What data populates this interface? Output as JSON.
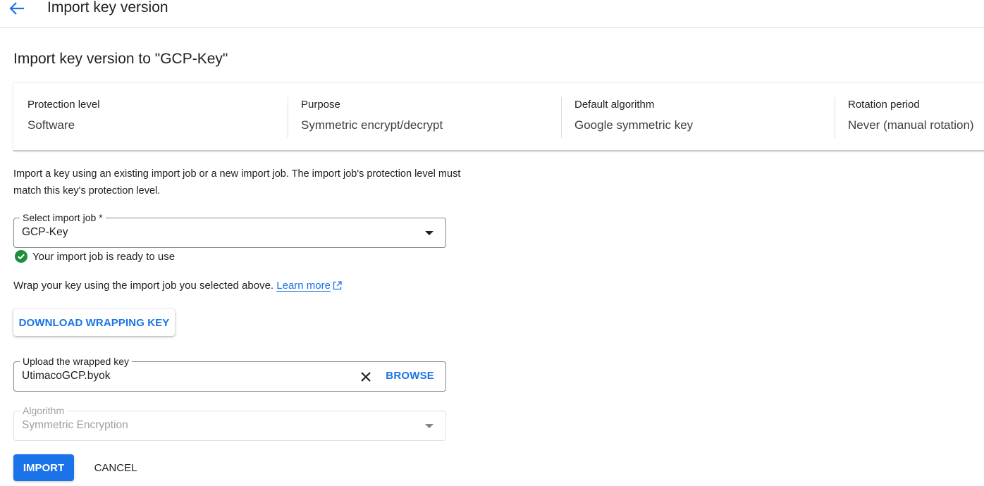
{
  "header": {
    "title": "Import key version",
    "back_icon": "arrow-back-icon"
  },
  "main": {
    "title": "Import key version to \"GCP-Key\""
  },
  "summary": [
    {
      "label": "Protection level",
      "value": "Software"
    },
    {
      "label": "Purpose",
      "value": "Symmetric encrypt/decrypt"
    },
    {
      "label": "Default algorithm",
      "value": "Google symmetric key"
    },
    {
      "label": "Rotation period",
      "value": "Never (manual rotation)"
    }
  ],
  "description": "Import a key using an existing import job or a new import job. The import job's protection level must match this key's protection level.",
  "import_job": {
    "label": "Select import job *",
    "value": "GCP-Key",
    "status_text": "Your import job is ready to use",
    "status_color": "#1e8e3e"
  },
  "wrap": {
    "text": "Wrap your key using the import job you selected above. ",
    "link_text": "Learn more",
    "download_button": "DOWNLOAD WRAPPING KEY"
  },
  "upload": {
    "label": "Upload the wrapped key",
    "value": "UtimacoGCP.byok",
    "browse_label": "BROWSE"
  },
  "algorithm": {
    "label": "Algorithm",
    "value": "Symmetric Encryption"
  },
  "actions": {
    "import_label": "IMPORT",
    "cancel_label": "CANCEL"
  },
  "colors": {
    "accent": "#1a73e8",
    "success": "#1e8e3e"
  }
}
